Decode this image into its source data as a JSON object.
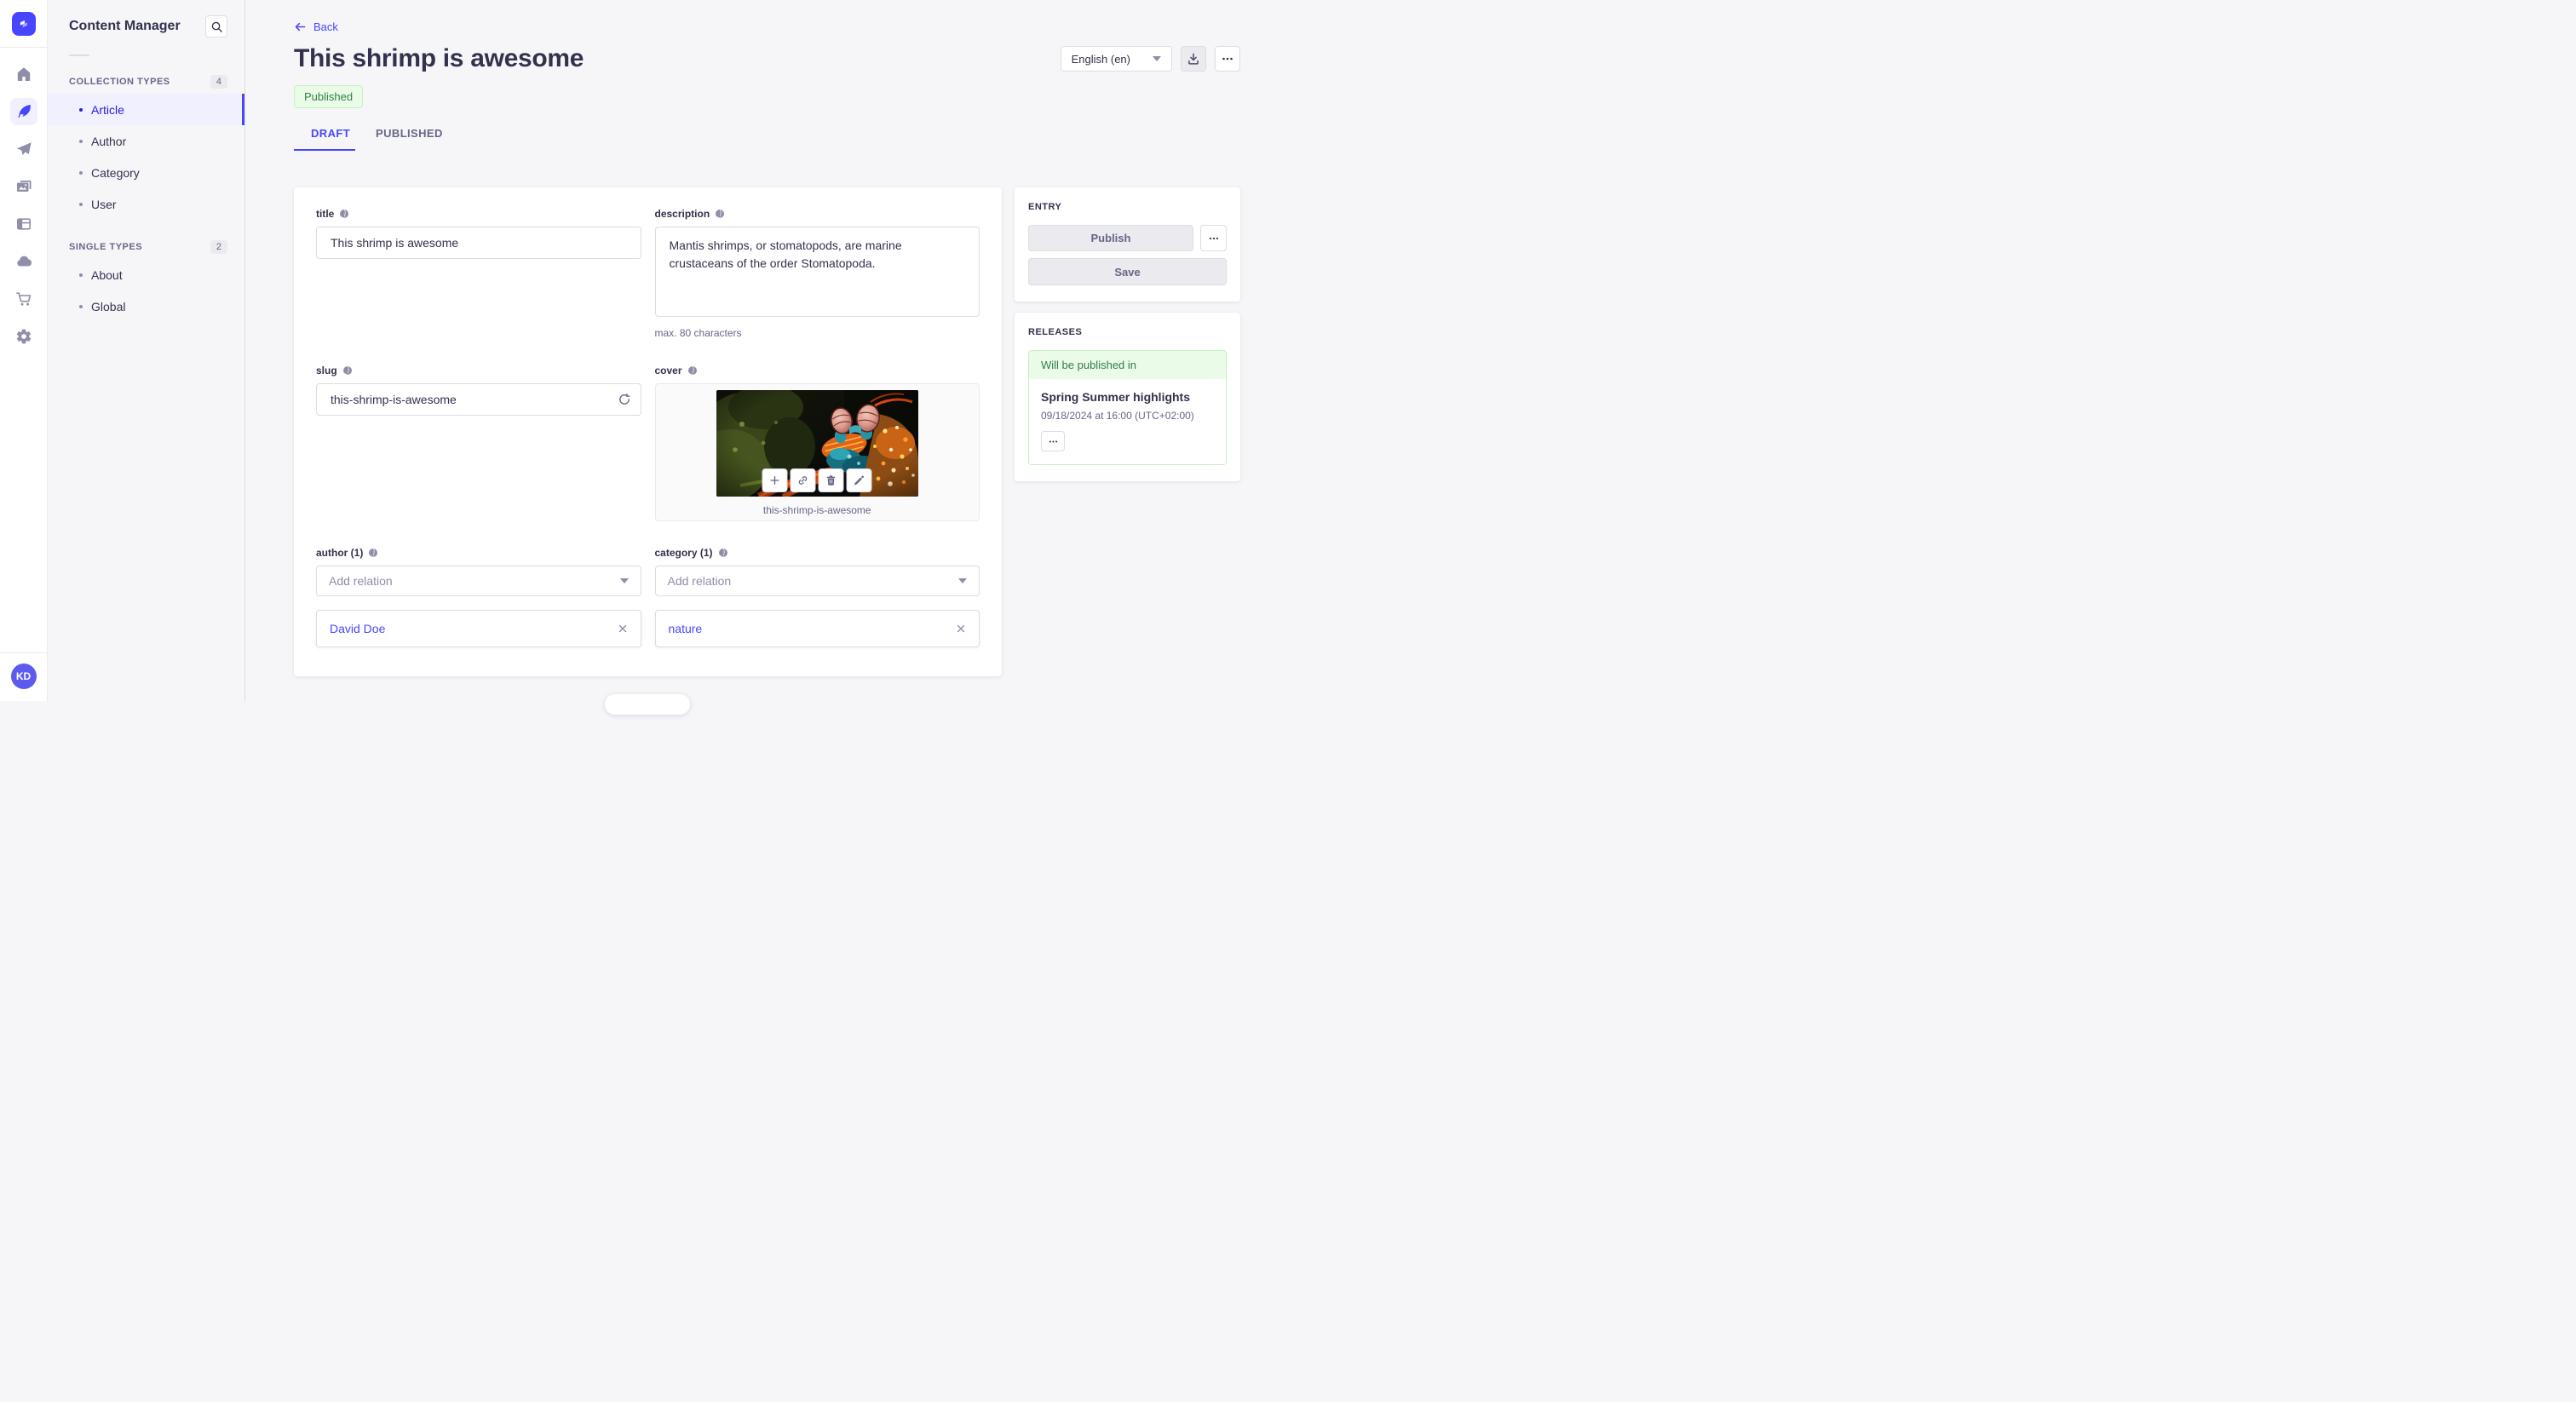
{
  "brand": {
    "avatar_initials": "KD"
  },
  "subnav": {
    "title": "Content Manager",
    "sections": [
      {
        "label": "COLLECTION TYPES",
        "count": "4",
        "items": [
          "Article",
          "Author",
          "Category",
          "User"
        ]
      },
      {
        "label": "SINGLE TYPES",
        "count": "2",
        "items": [
          "About",
          "Global"
        ]
      }
    ]
  },
  "header": {
    "back_label": "Back",
    "title": "This shrimp is awesome",
    "status_badge": "Published",
    "locale": "English (en)"
  },
  "tabs": {
    "items": [
      "DRAFT",
      "PUBLISHED"
    ]
  },
  "form": {
    "title": {
      "label": "title",
      "value": "This shrimp is awesome"
    },
    "description": {
      "label": "description",
      "value": "Mantis shrimps, or stomatopods, are marine crustaceans of the order Stomatopoda.",
      "hint": "max. 80 characters"
    },
    "slug": {
      "label": "slug",
      "value": "this-shrimp-is-awesome"
    },
    "cover": {
      "label": "cover",
      "caption": "this-shrimp-is-awesome"
    },
    "author": {
      "label": "author (1)",
      "placeholder": "Add relation",
      "relations": [
        "David Doe"
      ]
    },
    "category": {
      "label": "category (1)",
      "placeholder": "Add relation",
      "relations": [
        "nature"
      ]
    }
  },
  "entry_panel": {
    "title": "ENTRY",
    "publish_label": "Publish",
    "save_label": "Save"
  },
  "releases_panel": {
    "title": "RELEASES",
    "status": "Will be published in",
    "release_name": "Spring Summer highlights",
    "release_date": "09/18/2024 at 16:00 (UTC+02:00)"
  },
  "icons": {
    "search": "magnifier",
    "download": "tray-arrow-down",
    "more": "ellipsis",
    "caret": "triangle-down",
    "globe": "world",
    "refresh": "arrow-clockwise",
    "add": "plus",
    "link": "chain",
    "delete": "trash",
    "edit": "pencil",
    "close": "x",
    "back": "arrow-left",
    "home": "house",
    "content-manager": "feather",
    "releases": "paper-plane",
    "media-library": "pictures",
    "builder": "split-layout",
    "cloud": "cloud",
    "purchases": "cart",
    "settings": "gear"
  },
  "colors": {
    "primary": "#4945FF",
    "primary_active_text": "#271FE0",
    "primary_bg": "#F0F0FF",
    "success_text": "#328048",
    "success_bg": "#EAFBE7",
    "success_border": "#C6F0C2",
    "neutral_text": "#32324D",
    "muted_text": "#666687",
    "border": "#DCDCE4",
    "page_bg": "#F6F6F9"
  }
}
